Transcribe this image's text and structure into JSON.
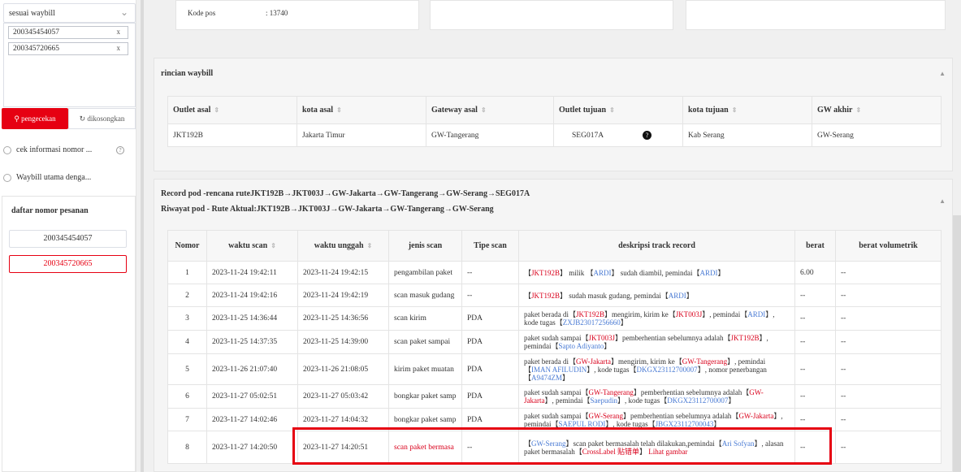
{
  "sidebar": {
    "select_value": "sesuai waybill",
    "tags": [
      "200345454057",
      "200345720665"
    ],
    "check_label": "pengecekan",
    "clear_label": "dikosongkan",
    "radio1": "cek informasi nomor ...",
    "radio2": "Waybill utama denga...",
    "order_title": "daftar nomor pesanan",
    "orders": [
      "200345454057",
      "200345720665"
    ]
  },
  "info": {
    "kode_pos_label": "Kode pos",
    "kode_pos_value": ": 13740"
  },
  "rincian": {
    "title": "rincian waybill",
    "headers": [
      "Outlet asal",
      "kota asal",
      "Gateway asal",
      "Outlet tujuan",
      "kota tujuan",
      "GW akhir"
    ],
    "row": [
      "JKT192B",
      "Jakarta Timur",
      "GW-Tangerang",
      "SEG017A",
      "Kab Serang",
      "GW-Serang"
    ]
  },
  "record": {
    "title1": "Record pod -rencana ruteJKT192B→JKT003J→GW-Jakarta→GW-Tangerang→GW-Serang→SEG017A",
    "title2": "Riwayat pod - Rute Aktual:JKT192B→JKT003J→GW-Jakarta→GW-Tangerang→GW-Serang",
    "headers": [
      "Nomor",
      "waktu scan",
      "waktu unggah",
      "jenis scan",
      "Tipe scan",
      "deskripsi track record",
      "berat",
      "berat volumetrik"
    ],
    "rows": [
      {
        "no": "1",
        "scan": "2023-11-24 19:42:11",
        "upload": "2023-11-24 19:42:15",
        "jenis": "pengambilan paket",
        "tipe": "--",
        "berat": "6.00",
        "vol": "--"
      },
      {
        "no": "2",
        "scan": "2023-11-24 19:42:16",
        "upload": "2023-11-24 19:42:19",
        "jenis": "scan masuk gudang",
        "tipe": "--",
        "berat": "--",
        "vol": "--"
      },
      {
        "no": "3",
        "scan": "2023-11-25 14:36:44",
        "upload": "2023-11-25 14:36:56",
        "jenis": "scan kirim",
        "tipe": "PDA",
        "berat": "--",
        "vol": "--"
      },
      {
        "no": "4",
        "scan": "2023-11-25 14:37:35",
        "upload": "2023-11-25 14:39:00",
        "jenis": "scan paket sampai",
        "tipe": "PDA",
        "berat": "--",
        "vol": "--"
      },
      {
        "no": "5",
        "scan": "2023-11-26 21:07:40",
        "upload": "2023-11-26 21:08:05",
        "jenis": "kirim paket muatan",
        "tipe": "PDA",
        "berat": "--",
        "vol": "--"
      },
      {
        "no": "6",
        "scan": "2023-11-27 05:02:51",
        "upload": "2023-11-27 05:03:42",
        "jenis": "bongkar paket samp",
        "tipe": "PDA",
        "berat": "--",
        "vol": "--"
      },
      {
        "no": "7",
        "scan": "2023-11-27 14:02:46",
        "upload": "2023-11-27 14:04:32",
        "jenis": "bongkar paket samp",
        "tipe": "PDA",
        "berat": "--",
        "vol": "--"
      },
      {
        "no": "8",
        "scan": "2023-11-27 14:20:50",
        "upload": "2023-11-27 14:20:51",
        "jenis": "scan paket bermasa",
        "tipe": "--",
        "berat": "--",
        "vol": "--"
      }
    ],
    "desc": {
      "r1a": "【",
      "r1b": "JKT192B",
      "r1c": "】 milik 【",
      "r1d": "ARDI",
      "r1e": "】 sudah diambil,  pemindai【",
      "r1f": "ARDI",
      "r1g": "】",
      "r2a": "【",
      "r2b": "JKT192B",
      "r2c": "】 sudah masuk gudang,  pemindai【",
      "r2d": "ARDI",
      "r2e": "】",
      "r3a": "paket berada di【",
      "r3b": "JKT192B",
      "r3c": "】mengirim, kirim ke【",
      "r3d": "JKT003J",
      "r3e": "】,  pemindai【",
      "r3f": "ARDI",
      "r3g": "】,  kode tugas【",
      "r3h": "ZXJB23017256660",
      "r3i": "】",
      "r4a": "paket sudah sampai【",
      "r4b": "JKT003J",
      "r4c": "】pemberhentian sebelumnya adalah【",
      "r4d": "JKT192B",
      "r4e": "】,  pemindai【",
      "r4f": "Sapto Adiyanto",
      "r4g": "】",
      "r5a": "paket berada di【",
      "r5b": "GW-Jakarta",
      "r5c": "】mengirim, kirim ke【",
      "r5d": "GW-Tangerang",
      "r5e": "】,  pemindai【",
      "r5f": "IMAN AFILUDIN",
      "r5g": "】,  kode tugas【",
      "r5h": "DKGX23112700007",
      "r5i": "】,  nomor penerbangan【",
      "r5j": "A9474ZM",
      "r5k": "】",
      "r6a": "paket sudah sampai【",
      "r6b": "GW-Tangerang",
      "r6c": "】pemberhentian sebelumnya adalah【",
      "r6d": "GW-Jakarta",
      "r6e": "】,  pemindai【",
      "r6f": "Saepudin",
      "r6g": "】,  kode tugas【",
      "r6h": "DKGX23112700007",
      "r6i": "】",
      "r7a": "paket sudah sampai【",
      "r7b": "GW-Serang",
      "r7c": "】pemberhentian sebelumnya adalah【",
      "r7d": "GW-Jakarta",
      "r7e": "】,  pemindai【",
      "r7f": "SAEPUL RODI",
      "r7g": "】,  kode tugas【",
      "r7h": "JBGX23112700043",
      "r7i": "】",
      "r8a": "【",
      "r8b": "GW-Serang",
      "r8c": "】scan paket bermasalah telah dilakukan,pemindai【",
      "r8d": "Ari Sofyan",
      "r8e": "】,  alasan paket bermasalah【",
      "r8f": "CrossLabel 贴错单",
      "r8g": "】",
      "r8h": "Lihat gambar"
    }
  },
  "colors": {
    "accent": "#e60012",
    "link": "#4a7bd4",
    "code": "#d9001b"
  }
}
